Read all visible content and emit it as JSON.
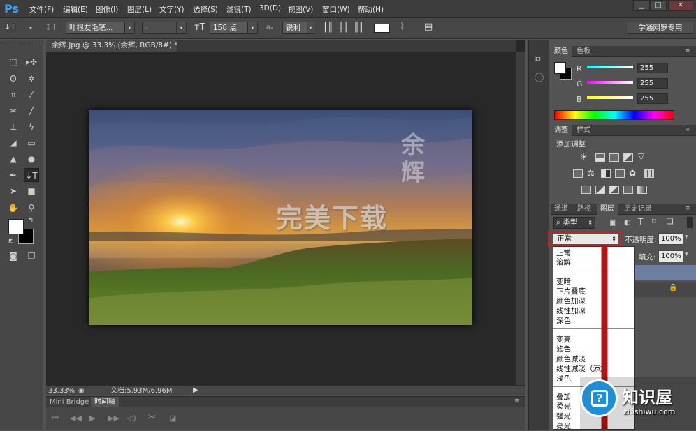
{
  "app": {
    "logo": "Ps"
  },
  "menu": [
    "文件(F)",
    "编辑(E)",
    "图像(I)",
    "图层(L)",
    "文字(Y)",
    "选择(S)",
    "滤镜(T)",
    "3D(D)",
    "视图(V)",
    "窗口(W)",
    "帮助(H)"
  ],
  "window_controls": {
    "minimize": "▁",
    "maximize": "□",
    "close": "✕"
  },
  "options": {
    "tool_glyph": "↓T",
    "font_family": "叶根友毛笔...",
    "font_style": "-",
    "font_size": "158 点",
    "aa_label": "aₐ",
    "aa_mode": "锐利",
    "workspace": "学通网罗专用"
  },
  "document": {
    "tab_title": "余辉.jpg @ 33.3% (余辉, RGB/8#) *",
    "close": "×",
    "zoom": "33.33%",
    "doc_info": "文档:5.93M/6.96M",
    "watermark_top": "余辉",
    "watermark_main": "完美下载"
  },
  "timeline": {
    "tabs": [
      "Mini Bridge",
      "时间轴"
    ]
  },
  "color_panel": {
    "tabs": [
      "颜色",
      "色板"
    ],
    "channels": [
      {
        "label": "R",
        "value": "255"
      },
      {
        "label": "G",
        "value": "255"
      },
      {
        "label": "B",
        "value": "255"
      }
    ]
  },
  "adjust_panel": {
    "tabs": [
      "调整",
      "样式"
    ],
    "title": "添加调整"
  },
  "layers_panel": {
    "tabs": [
      "通道",
      "路径",
      "图层",
      "历史记录"
    ],
    "filter_kind": "类型",
    "blend_mode": "正常",
    "opacity_label": "不透明度:",
    "opacity_value": "100%",
    "fill_label": "填充:",
    "fill_value": "100%"
  },
  "blend_modes": [
    [
      "正常",
      "溶解"
    ],
    [
      "变暗",
      "正片叠底",
      "颜色加深",
      "线性加深",
      "深色"
    ],
    [
      "变亮",
      "滤色",
      "颜色减淡",
      "线性减淡（添加",
      "浅色"
    ],
    [
      "叠加",
      "柔光",
      "强光",
      "亮光"
    ]
  ],
  "site_badge": {
    "name": "知识屋",
    "url": "zhishiwu.com"
  },
  "colors": {
    "accent": "#31a8ff",
    "highlight": "#cc1c1c",
    "badge": "#1d8fd8"
  }
}
